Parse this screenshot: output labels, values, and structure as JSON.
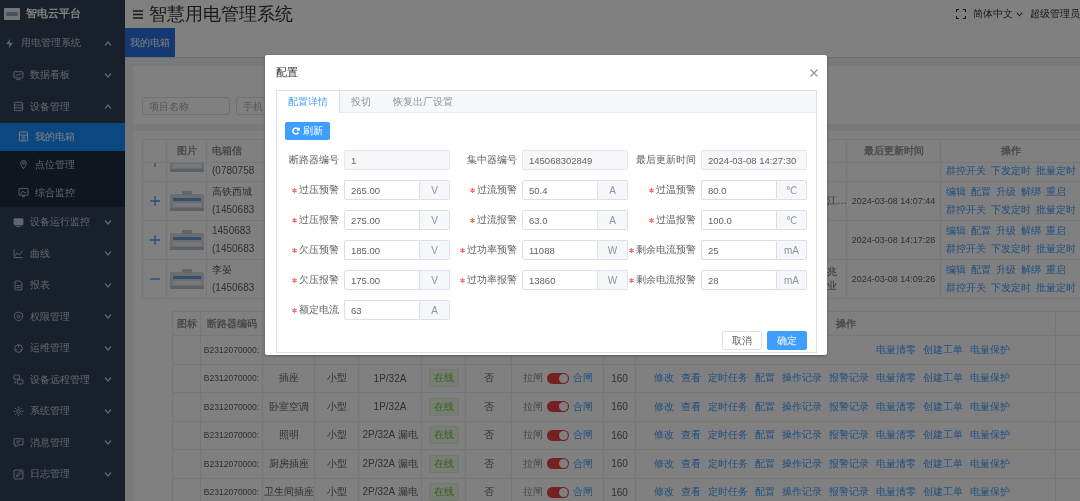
{
  "sidebar": {
    "logo": "智电云平台",
    "menu": [
      {
        "label": "用电管理系统",
        "expanded": true,
        "children": [
          {
            "label": "数据看板",
            "expanded": false
          },
          {
            "label": "设备管理",
            "expanded": true,
            "children": [
              {
                "label": "我的电箱",
                "selected": true
              },
              {
                "label": "点位管理",
                "selected": false
              },
              {
                "label": "综合监控",
                "selected": false
              }
            ]
          },
          {
            "label": "设备运行监控",
            "expanded": false
          },
          {
            "label": "曲线",
            "expanded": false
          },
          {
            "label": "报表",
            "expanded": false
          },
          {
            "label": "权限管理",
            "expanded": false
          },
          {
            "label": "运维管理",
            "expanded": false
          },
          {
            "label": "设备远程管理",
            "expanded": false
          },
          {
            "label": "系统管理",
            "expanded": false
          },
          {
            "label": "消息管理",
            "expanded": false
          },
          {
            "label": "日志管理",
            "expanded": false
          }
        ]
      }
    ]
  },
  "header": {
    "title": "智慧用电管理系统",
    "language": "简体中文",
    "user": "超级管理员"
  },
  "tags": [
    {
      "label": "我的电箱",
      "selected": true
    }
  ],
  "search": [
    {
      "placeholder": "项目名称"
    },
    {
      "placeholder": "手机"
    }
  ],
  "boxes": {
    "columns": {
      "image": "图片",
      "info": "电箱信",
      "updated": "最后更新时间",
      "actions": "操作"
    },
    "rows": [
      {
        "expanded": false,
        "info": [
          "(0780758"
        ],
        "actions": [
          [
            "群控开关",
            "下发定时",
            "批量定时"
          ]
        ]
      },
      {
        "expanded": false,
        "info": [
          "高铁西城",
          "(1450683"
        ],
        "column_4": "江…",
        "updated": "2024-03-08 14:07:44",
        "actions": [
          [
            "编辑",
            "配置",
            "升级",
            "解绑",
            "重启"
          ],
          [
            "群控开关",
            "下发定时",
            "批量定时"
          ]
        ]
      },
      {
        "expanded": false,
        "info": [
          "1450683",
          "(1450683"
        ],
        "updated": "2024-03-08 14:17:28",
        "actions": [
          [
            "编辑",
            "配置",
            "升级",
            "解绑",
            "重启"
          ],
          [
            "群控开关",
            "下发定时",
            "批量定时"
          ]
        ]
      },
      {
        "expanded": true,
        "info": [
          "李晏",
          "(1450683"
        ],
        "column_4": "兆业",
        "updated": "2024-03-08 14:09:26",
        "actions": [
          [
            "编辑",
            "配置",
            "升级",
            "解绑",
            "重启"
          ],
          [
            "群控开关",
            "下发定时",
            "批量定时"
          ]
        ]
      }
    ]
  },
  "breakers": {
    "columns": {
      "icon": "图标",
      "code": "断路器编码",
      "actions": "操作"
    },
    "rows": [
      {
        "code": "B2312070000:",
        "actions": [
          "电量清零",
          "创建工单",
          "电量保护"
        ]
      },
      {
        "code": "B2312070000:",
        "name": "插座",
        "type": "小型",
        "spec": "1P/32A",
        "status": "在线",
        "column_7": "否",
        "off_label": "拉闸",
        "on": true,
        "on_label": "合闸",
        "value": "160",
        "actions": [
          "修改",
          "查看",
          "定时任务",
          "配置",
          "操作记录",
          "报警记录",
          "电量清零",
          "创建工单",
          "电量保护"
        ]
      },
      {
        "code": "B2312070000:",
        "name": "卧室空调",
        "type": "小型",
        "spec": "1P/32A",
        "status": "在线",
        "column_7": "否",
        "off_label": "拉闸",
        "on": true,
        "on_label": "合闸",
        "value": "160",
        "actions": [
          "修改",
          "查看",
          "定时任务",
          "配置",
          "操作记录",
          "报警记录",
          "电量清零",
          "创建工单",
          "电量保护"
        ]
      },
      {
        "code": "B2312070000:",
        "name": "照明",
        "type": "小型",
        "spec": "2P/32A 漏电",
        "status": "在线",
        "column_7": "否",
        "off_label": "拉闸",
        "on": true,
        "on_label": "合闸",
        "value": "160",
        "actions": [
          "修改",
          "查看",
          "定时任务",
          "配置",
          "操作记录",
          "报警记录",
          "电量清零",
          "创建工单",
          "电量保护"
        ]
      },
      {
        "code": "B2312070000:",
        "name": "厨房插座",
        "type": "小型",
        "spec": "2P/32A 漏电",
        "status": "在线",
        "column_7": "否",
        "off_label": "拉闸",
        "on": true,
        "on_label": "合闸",
        "value": "160",
        "actions": [
          "修改",
          "查看",
          "定时任务",
          "配置",
          "操作记录",
          "报警记录",
          "电量清零",
          "创建工单",
          "电量保护"
        ]
      },
      {
        "code": "B2312070000:",
        "name": "卫生间插座",
        "type": "小型",
        "spec": "2P/32A 漏电",
        "status": "在线",
        "column_7": "否",
        "off_label": "拉闸",
        "on": true,
        "on_label": "合闸",
        "value": "160",
        "actions": [
          "修改",
          "查看",
          "定时任务",
          "配置",
          "操作记录",
          "报警记录",
          "电量清零",
          "创建工单",
          "电量保护"
        ]
      }
    ]
  },
  "dialog": {
    "title": "配置",
    "tabs": [
      {
        "label": "配置详情",
        "selected": true
      },
      {
        "label": "投切",
        "selected": false
      },
      {
        "label": "恢复出厂设置",
        "selected": false
      }
    ],
    "refresh": "刷新",
    "fields": [
      {
        "label": "断路器编号",
        "kind": "readonly",
        "required": false,
        "value": "1"
      },
      {
        "label": "集中器编号",
        "kind": "readonly",
        "required": false,
        "value": "145068302849"
      },
      {
        "label": "最后更新时间",
        "kind": "readonly",
        "required": false,
        "value": "2024-03-08 14:27:30"
      },
      {
        "label": "过压预警",
        "kind": "unit",
        "required": true,
        "value": "265.00",
        "unit": "V"
      },
      {
        "label": "过流预警",
        "kind": "unit",
        "required": true,
        "value": "50.4",
        "unit": "A"
      },
      {
        "label": "过温预警",
        "kind": "unit",
        "required": true,
        "value": "80.0",
        "unit": "℃"
      },
      {
        "label": "过压报警",
        "kind": "unit",
        "required": true,
        "value": "275.00",
        "unit": "V"
      },
      {
        "label": "过流报警",
        "kind": "unit",
        "required": true,
        "value": "63.0",
        "unit": "A"
      },
      {
        "label": "过温报警",
        "kind": "unit",
        "required": true,
        "value": "100.0",
        "unit": "℃"
      },
      {
        "label": "欠压预警",
        "kind": "unit",
        "required": true,
        "value": "185.00",
        "unit": "V"
      },
      {
        "label": "过功率预警",
        "kind": "unit",
        "required": true,
        "value": "11088",
        "unit": "W"
      },
      {
        "label": "剩余电流预警",
        "kind": "unit",
        "required": true,
        "value": "25",
        "unit": "mA"
      },
      {
        "label": "欠压报警",
        "kind": "unit",
        "required": true,
        "value": "175.00",
        "unit": "V"
      },
      {
        "label": "过功率报警",
        "kind": "unit",
        "required": true,
        "value": "13860",
        "unit": "W"
      },
      {
        "label": "剩余电流报警",
        "kind": "unit",
        "required": true,
        "value": "28",
        "unit": "mA"
      },
      {
        "label": "额定电流",
        "kind": "unit",
        "required": true,
        "value": "63",
        "unit": "A"
      }
    ],
    "buttons": [
      {
        "label": "取消",
        "kind": "default"
      },
      {
        "label": "确定",
        "kind": "primary"
      }
    ]
  }
}
